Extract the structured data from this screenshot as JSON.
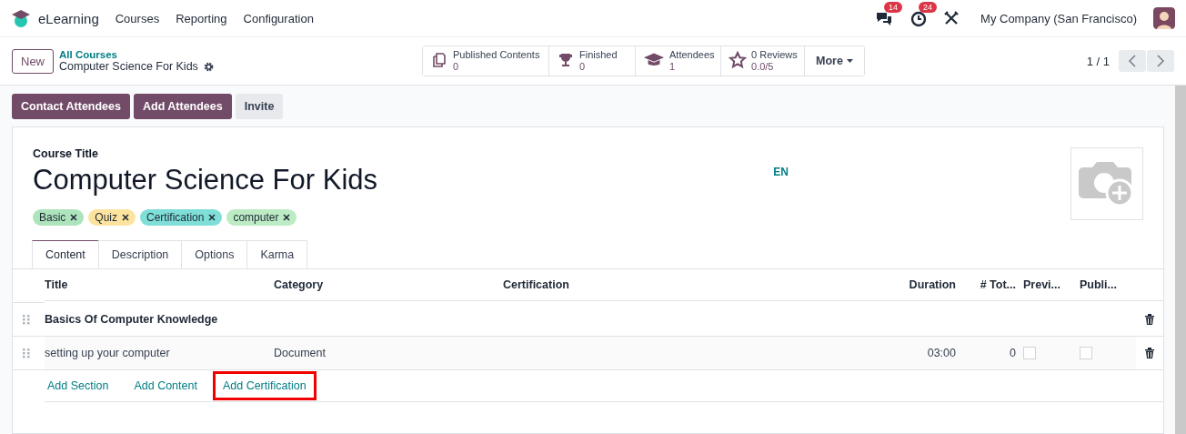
{
  "navbar": {
    "app_name": "eLearning",
    "menu": [
      "Courses",
      "Reporting",
      "Configuration"
    ],
    "messages_count": "14",
    "activities_count": "24",
    "company": "My Company (San Francisco)"
  },
  "control_panel": {
    "new_button": "New",
    "breadcrumb": "All Courses",
    "record_name": "Computer Science For Kids",
    "stats": [
      {
        "kind": "contents",
        "label": "Published Contents",
        "value": "0"
      },
      {
        "kind": "finished",
        "label": "Finished",
        "value": "0"
      },
      {
        "kind": "attendees",
        "label": "Attendees",
        "value": "1"
      },
      {
        "kind": "reviews",
        "label": "0 Reviews",
        "value": "0.0/5"
      }
    ],
    "more_button": "More",
    "pager": "1 / 1"
  },
  "actions": [
    {
      "label": "Contact Attendees",
      "primary": true
    },
    {
      "label": "Add Attendees",
      "primary": true
    },
    {
      "label": "Invite",
      "primary": false
    }
  ],
  "form": {
    "field_label": "Course Title",
    "title": "Computer Science For Kids",
    "language": "EN",
    "tags": [
      {
        "label": "Basic",
        "color": "#ade4bc"
      },
      {
        "label": "Quiz",
        "color": "#fce49e"
      },
      {
        "label": "Certification",
        "color": "#7fdfd8"
      },
      {
        "label": "computer",
        "color": "#bcebc4"
      }
    ],
    "tabs": [
      {
        "label": "Content",
        "selected": true
      },
      {
        "label": "Description",
        "selected": false
      },
      {
        "label": "Options",
        "selected": false
      },
      {
        "label": "Karma",
        "selected": false
      }
    ],
    "table": {
      "columns": [
        "Title",
        "Category",
        "Certification",
        "Duration",
        "# Tot...",
        "Previ...",
        "Publi..."
      ],
      "rows": [
        {
          "kind": "section",
          "title": "Basics Of Computer Knowledge"
        },
        {
          "kind": "content",
          "title": "setting up your computer",
          "category": "Document",
          "duration": "03:00",
          "total": "0",
          "preview": false,
          "published": false
        }
      ],
      "add_links": [
        {
          "label": "Add Section",
          "highlighted": false
        },
        {
          "label": "Add Content",
          "highlighted": false
        },
        {
          "label": "Add Certification",
          "highlighted": true
        }
      ]
    }
  }
}
